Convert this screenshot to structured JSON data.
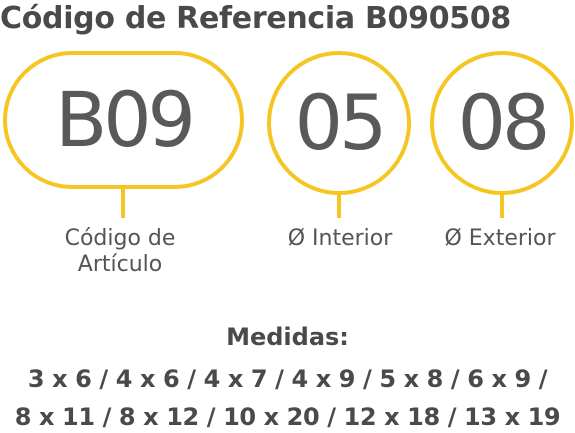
{
  "title": "Código de Referencia B090508",
  "segments": [
    {
      "code": "B09",
      "label_lines": [
        "Código de",
        "Artículo"
      ]
    },
    {
      "code": "05",
      "label": "Ø Interior"
    },
    {
      "code": "08",
      "label": "Ø Exterior"
    }
  ],
  "medidas": {
    "heading": "Medidas:",
    "line1": "3 x 6 / 4 x 6 / 4 x 7 / 4 x 9 / 5 x 8 / 6 x 9 /",
    "line2": "8 x 11 / 8 x 12 / 10 x 20 / 12 x 18 / 13 x 19"
  },
  "colors": {
    "accent": "#f5c623",
    "text": "#4a4a4a"
  }
}
